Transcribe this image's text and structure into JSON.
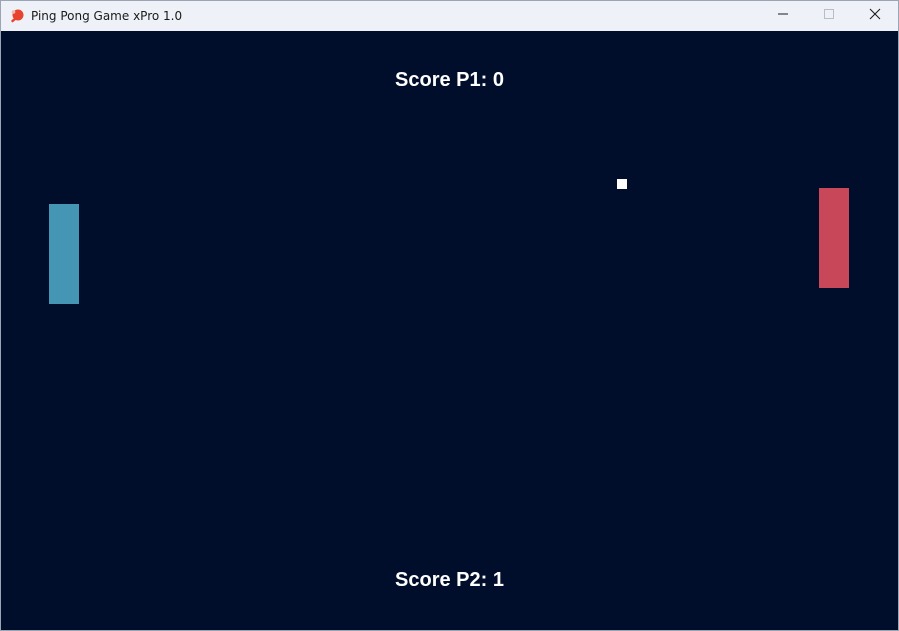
{
  "window": {
    "title": "Ping Pong Game xPro 1.0",
    "icon": "ping-pong-paddle-icon",
    "controls": [
      "minimize-icon",
      "maximize-icon",
      "close-icon"
    ]
  },
  "game": {
    "background_color": "#000d2b",
    "scores": {
      "p1_label": "Score P1: 0",
      "p2_label": "Score P2: 1"
    },
    "paddles": {
      "left_color": "#4596b4",
      "right_color": "#c8485a"
    },
    "ball_color": "#ffffff"
  }
}
